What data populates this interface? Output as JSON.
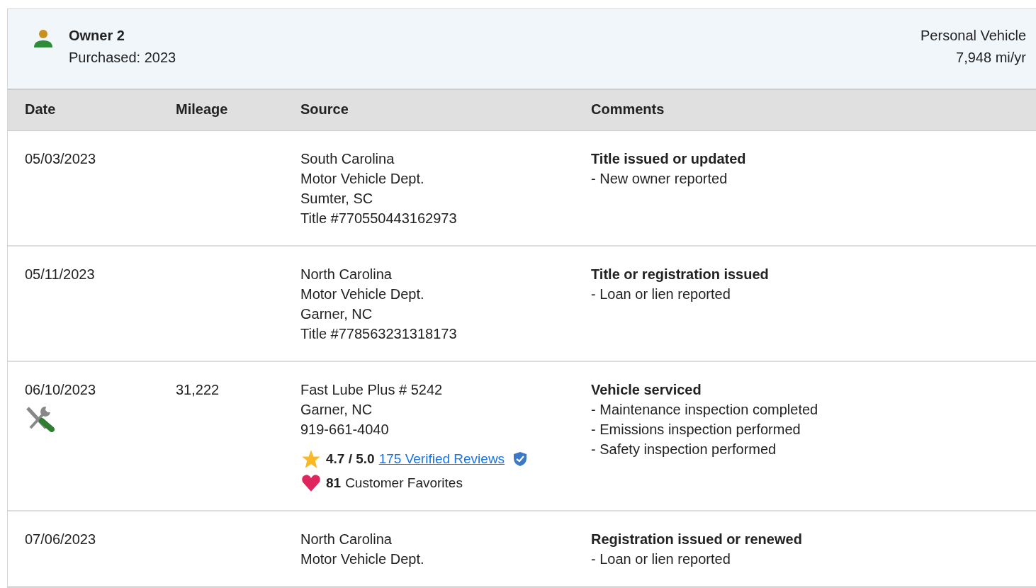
{
  "owner": {
    "name": "Owner 2",
    "purchased": "Purchased: 2023",
    "usage": "Personal Vehicle",
    "mileage_rate": "7,948 mi/yr"
  },
  "table": {
    "columns": [
      "Date",
      "Mileage",
      "Source",
      "Comments"
    ],
    "rows": [
      {
        "date": "05/03/2023",
        "service": false,
        "mileage": "",
        "source": [
          "South Carolina",
          "Motor Vehicle Dept.",
          "Sumter, SC",
          "Title #770550443162973"
        ],
        "comment_title": "Title issued or updated",
        "comments": [
          "- New owner reported"
        ]
      },
      {
        "date": "05/11/2023",
        "service": false,
        "mileage": "",
        "source": [
          "North Carolina",
          "Motor Vehicle Dept.",
          "Garner, NC",
          "Title #778563231318173"
        ],
        "comment_title": "Title or registration issued",
        "comments": [
          "- Loan or lien reported"
        ]
      },
      {
        "date": "06/10/2023",
        "service": true,
        "mileage": "31,222",
        "source": [
          "Fast Lube Plus # 5242",
          "Garner, NC",
          "919-661-4040"
        ],
        "rating": {
          "score": "4.7 / 5.0",
          "reviews": "175 Verified Reviews",
          "favorites_count": "81",
          "favorites_label": "Customer Favorites"
        },
        "comment_title": "Vehicle serviced",
        "comments": [
          "- Maintenance inspection completed",
          "- Emissions inspection performed",
          "- Safety inspection performed"
        ]
      },
      {
        "date": "07/06/2023",
        "service": false,
        "mileage": "",
        "source": [
          "North Carolina",
          "Motor Vehicle Dept."
        ],
        "comment_title": "Registration issued or renewed",
        "comments": [
          "- Loan or lien reported"
        ]
      }
    ]
  }
}
